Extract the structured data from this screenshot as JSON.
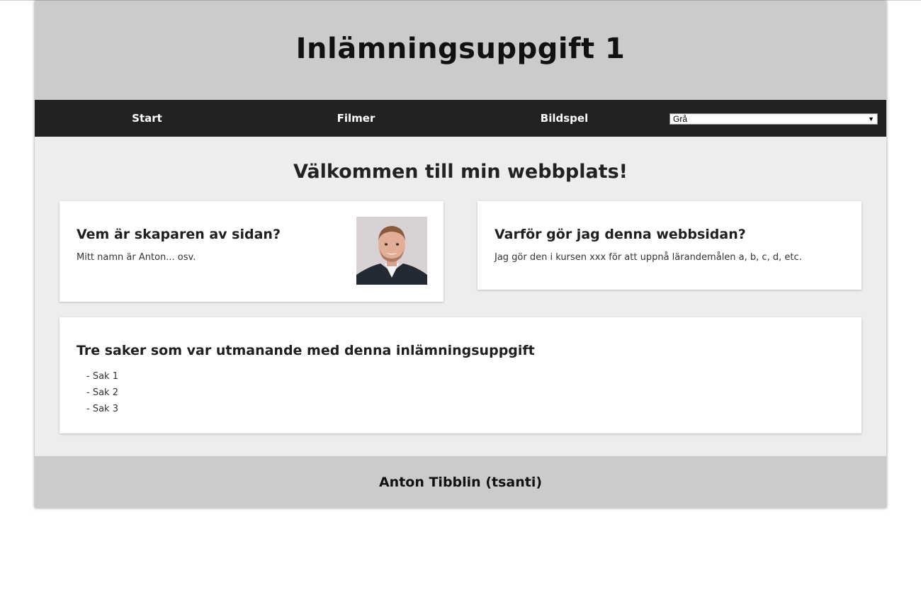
{
  "header": {
    "title": "Inlämningsuppgift 1"
  },
  "nav": {
    "items": [
      {
        "label": "Start"
      },
      {
        "label": "Filmer"
      },
      {
        "label": "Bildspel"
      }
    ],
    "theme_select": {
      "value": "Grå",
      "icon": "chevron-down-icon"
    }
  },
  "main": {
    "welcome": "Välkommen till min webbplats!",
    "cards": {
      "creator": {
        "title": "Vem är skaparen av sidan?",
        "text": "Mitt namn är Anton... osv.",
        "photo": "profile-photo"
      },
      "why": {
        "title": "Varför gör jag denna webbsidan?",
        "text": "Jag gör den i kursen xxx för att uppnå lärandemålen a, b, c, d, etc."
      },
      "challenges": {
        "title": "Tre saker som var utmanande med denna inlämningsuppgift",
        "items": [
          "- Sak 1",
          "- Sak 2",
          "- Sak 3"
        ]
      }
    }
  },
  "footer": {
    "text": "Anton Tibblin (tsanti)"
  },
  "colors": {
    "header_bg": "#cbcbcb",
    "nav_bg": "#222222",
    "main_bg": "#ededed",
    "card_bg": "#ffffff"
  }
}
